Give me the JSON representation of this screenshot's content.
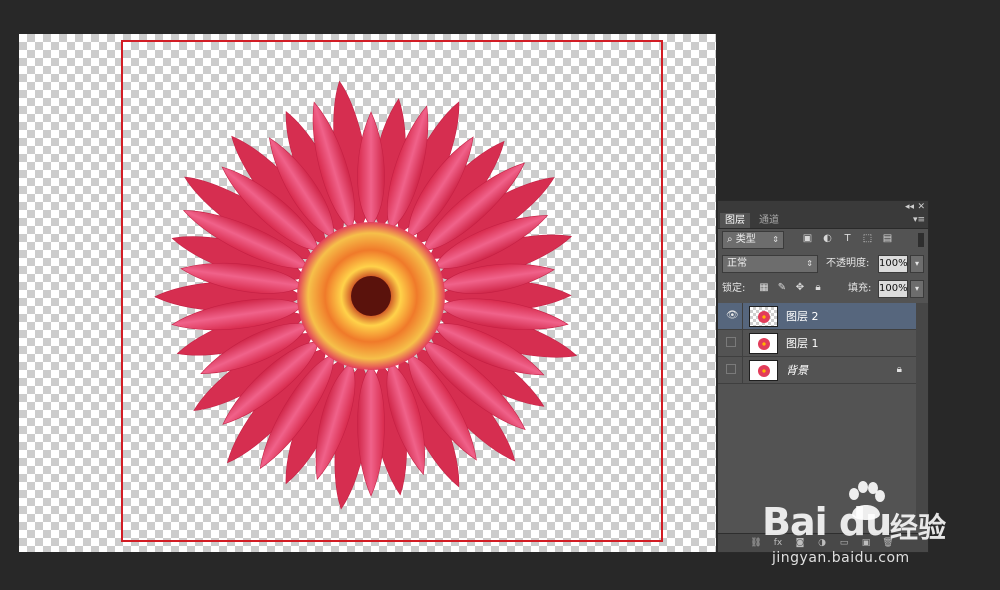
{
  "panel": {
    "collapse_glyph": "◂◂",
    "close_glyph": "✕",
    "menu_glyph": "▾≡",
    "tabs": [
      {
        "label": "图层",
        "active": true
      },
      {
        "label": "通道",
        "active": false
      }
    ],
    "filter": {
      "label": "类型",
      "search_glyph": "⌕"
    },
    "blend_mode": "正常",
    "opacity": {
      "label": "不透明度:",
      "value": "100%"
    },
    "lock_label": "锁定:",
    "fill": {
      "label": "填充:",
      "value": "100%"
    },
    "layers": [
      {
        "name": "图层 2",
        "visible": true,
        "active": true,
        "thumb": "flower"
      },
      {
        "name": "图层 1",
        "visible": false,
        "active": false,
        "thumb": "flower"
      },
      {
        "name": "背景",
        "visible": false,
        "active": false,
        "thumb": "rect",
        "locked": true
      }
    ]
  },
  "watermark": {
    "logo": "Bai du",
    "brand": "经验",
    "url": "jingyan.baidu.com"
  },
  "colors": {
    "selection": "#d21c24",
    "petal": "#e23c5a",
    "active_layer": "#56667d"
  }
}
